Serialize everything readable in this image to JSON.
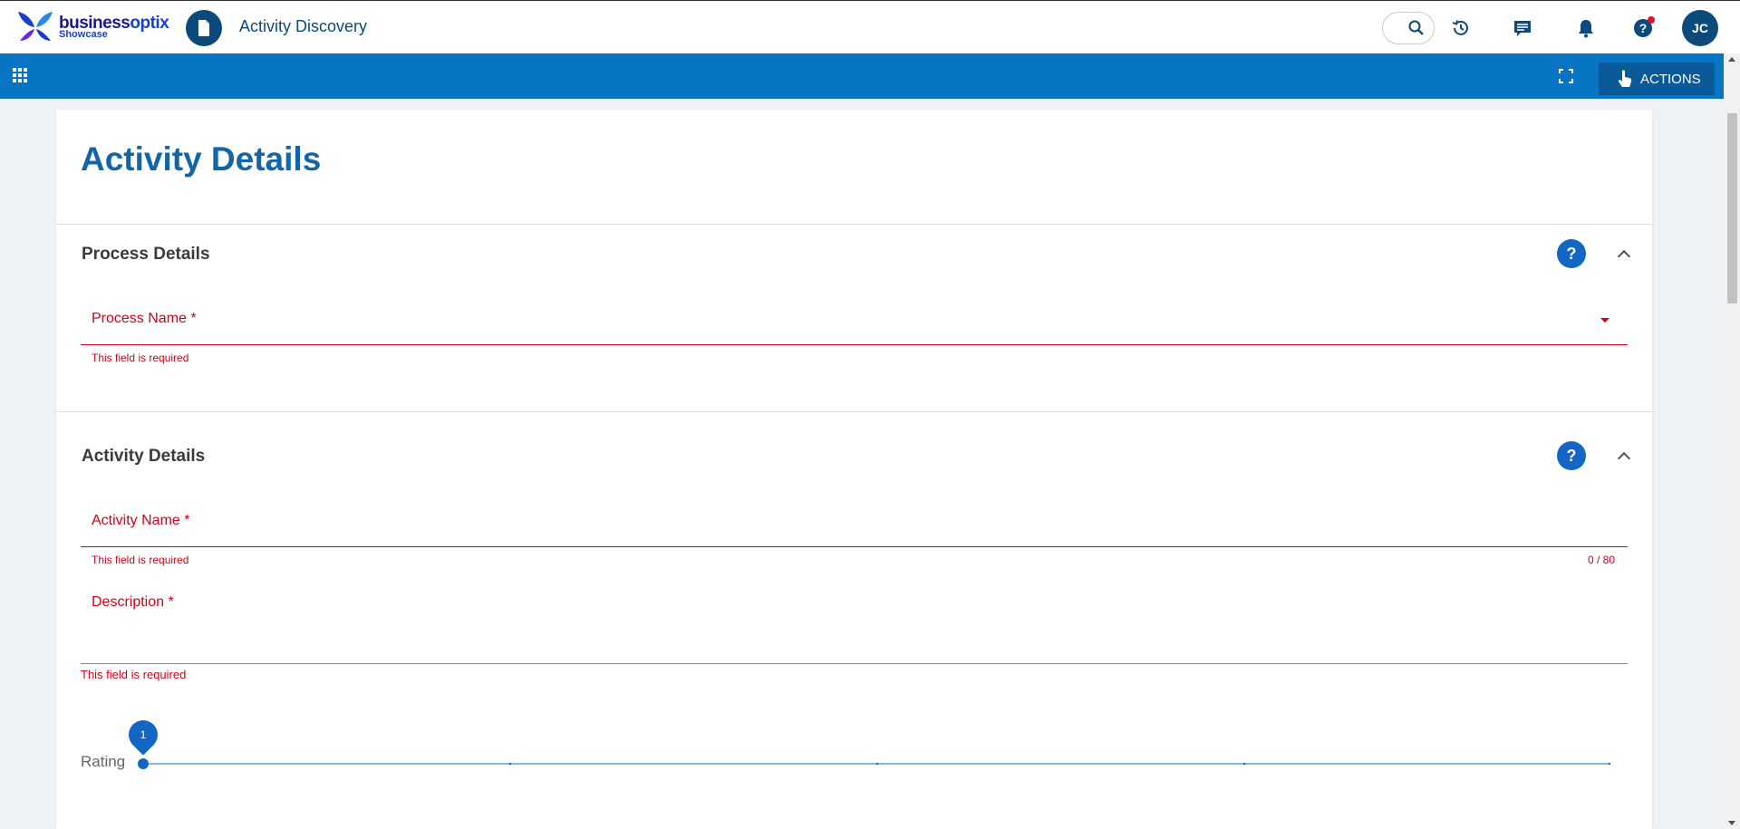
{
  "header": {
    "logo_word_a": "business",
    "logo_word_b": "optix",
    "logo_sub": "Showcase",
    "app_title": "Activity Discovery",
    "avatar_initials": "JC"
  },
  "toolbar": {
    "actions_label": "ACTIONS"
  },
  "page": {
    "title": "Activity Details"
  },
  "sections": {
    "process": {
      "title": "Process Details",
      "help": "?",
      "field_label": "Process Name *",
      "error": "This field is required"
    },
    "activity": {
      "title": "Activity Details",
      "help": "?",
      "name_label": "Activity Name *",
      "name_error": "This field is required",
      "name_counter": "0 / 80",
      "description_label": "Description *",
      "description_error": "This field is required",
      "rating_label": "Rating",
      "rating_value": "1"
    }
  },
  "colors": {
    "brand": "#0b4a7a",
    "toolbar": "#0874c4",
    "error": "#d0021b",
    "accent": "#1466c4"
  }
}
